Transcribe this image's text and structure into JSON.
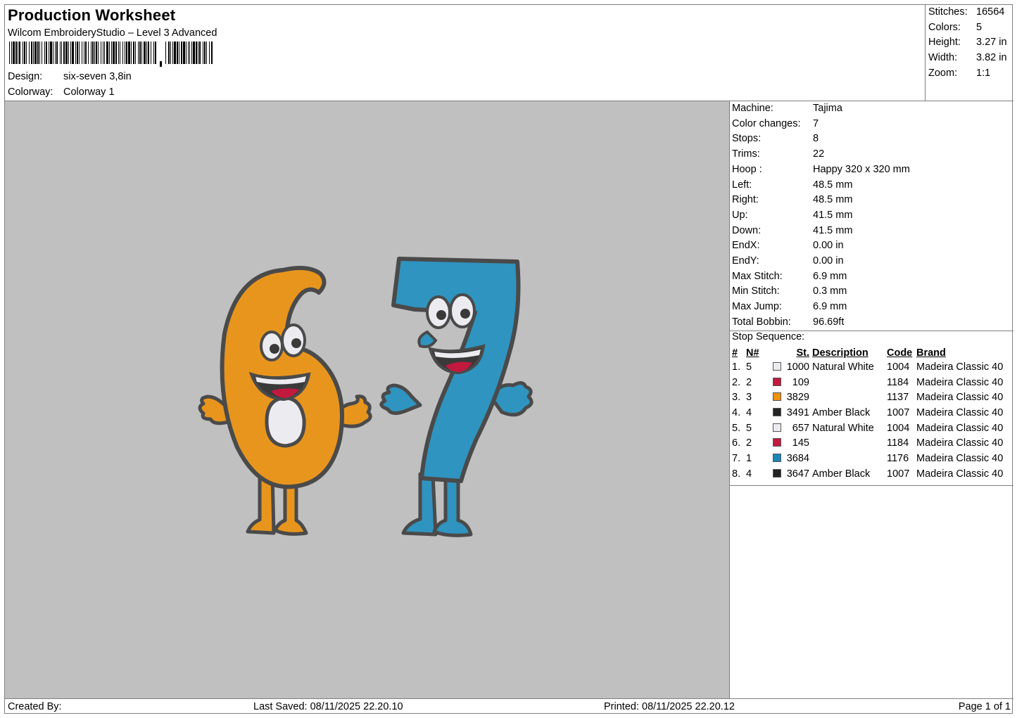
{
  "header": {
    "title": "Production Worksheet",
    "software": "Wilcom EmbroideryStudio – Level 3 Advanced",
    "design_label": "Design:",
    "design_value": "six-seven 3,8in",
    "colorway_label": "Colorway:",
    "colorway_value": "Colorway 1"
  },
  "summary": {
    "stitches_label": "Stitches:",
    "stitches": "16564",
    "colors_label": "Colors:",
    "colors": "5",
    "height_label": "Height:",
    "height": "3.27 in",
    "width_label": "Width:",
    "width": "3.82 in",
    "zoom_label": "Zoom:",
    "zoom": "1:1"
  },
  "machine_info": [
    {
      "label": "Machine:",
      "value": "Tajima"
    },
    {
      "label": "Color changes:",
      "value": "7"
    },
    {
      "label": "Stops:",
      "value": "8"
    },
    {
      "label": "Trims:",
      "value": "22"
    },
    {
      "label": "Hoop :",
      "value": "Happy 320 x 320 mm"
    },
    {
      "label": "Left:",
      "value": "48.5 mm"
    },
    {
      "label": "Right:",
      "value": "48.5 mm"
    },
    {
      "label": "Up:",
      "value": "41.5 mm"
    },
    {
      "label": "Down:",
      "value": "41.5 mm"
    },
    {
      "label": "EndX:",
      "value": "0.00 in"
    },
    {
      "label": "EndY:",
      "value": "0.00 in"
    },
    {
      "label": "Max Stitch:",
      "value": "6.9 mm"
    },
    {
      "label": "Min Stitch:",
      "value": "0.3 mm"
    },
    {
      "label": "Max Jump:",
      "value": "6.9 mm"
    },
    {
      "label": "Total Bobbin:",
      "value": "96.69ft"
    }
  ],
  "stop_sequence": {
    "title": "Stop Sequence:",
    "headers": {
      "num": "#",
      "n": "N#",
      "st": "St.",
      "desc": "Description",
      "code": "Code",
      "brand": "Brand"
    },
    "rows": [
      {
        "num": "1.",
        "n": "5",
        "color": "#ecebf0",
        "st": "1000",
        "desc": "Natural White",
        "code": "1004",
        "brand": "Madeira Classic 40"
      },
      {
        "num": "2.",
        "n": "2",
        "color": "#c2193f",
        "st": "109",
        "desc": "",
        "code": "1184",
        "brand": "Madeira Classic 40"
      },
      {
        "num": "3.",
        "n": "3",
        "color": "#f0920e",
        "st": "3829",
        "desc": "",
        "code": "1137",
        "brand": "Madeira Classic 40"
      },
      {
        "num": "4.",
        "n": "4",
        "color": "#242424",
        "st": "3491",
        "desc": "Amber Black",
        "code": "1007",
        "brand": "Madeira Classic 40"
      },
      {
        "num": "5.",
        "n": "5",
        "color": "#ecebf0",
        "st": "657",
        "desc": "Natural White",
        "code": "1004",
        "brand": "Madeira Classic 40"
      },
      {
        "num": "6.",
        "n": "2",
        "color": "#c2193f",
        "st": "145",
        "desc": "",
        "code": "1184",
        "brand": "Madeira Classic 40"
      },
      {
        "num": "7.",
        "n": "1",
        "color": "#1a86b8",
        "st": "3684",
        "desc": "",
        "code": "1176",
        "brand": "Madeira Classic 40"
      },
      {
        "num": "8.",
        "n": "4",
        "color": "#242424",
        "st": "3647",
        "desc": "Amber Black",
        "code": "1007",
        "brand": "Madeira Classic 40"
      }
    ]
  },
  "footer": {
    "created_by": "Created By:",
    "last_saved": "Last Saved: 08/11/2025 22.20.10",
    "printed": "Printed: 08/11/2025 22.20.12",
    "page": "Page 1 of 1"
  },
  "preview": {
    "background": "#c0c0c0",
    "outline_color": "#4a4a4a",
    "six_color": "#e8951e",
    "seven_color": "#2f94bf",
    "mouth_color": "#c2193f",
    "white_color": "#ecebf0"
  }
}
